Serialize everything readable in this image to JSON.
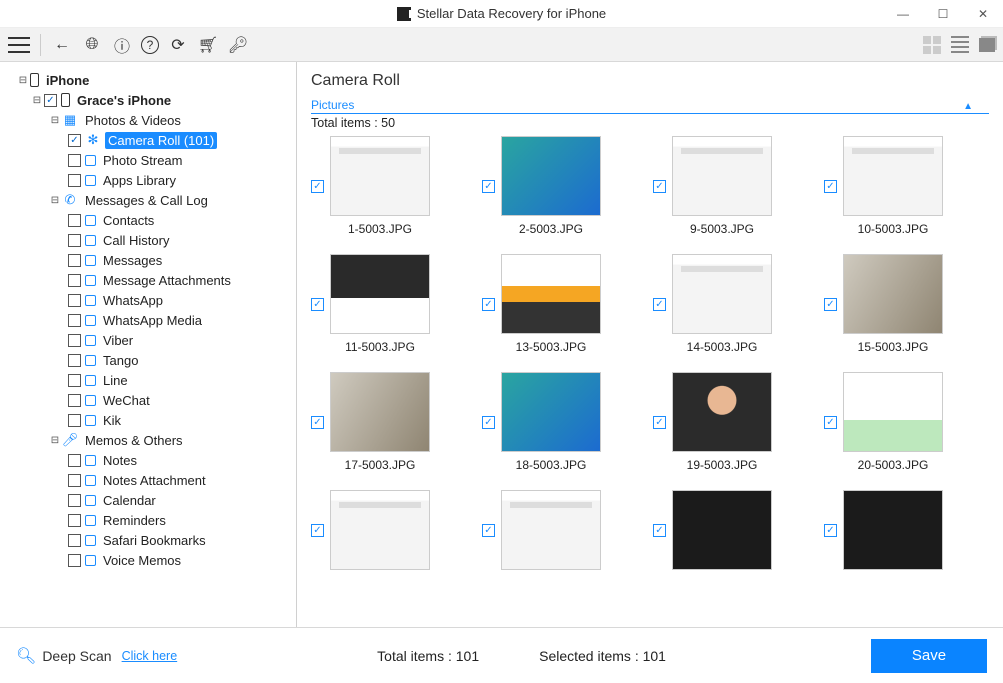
{
  "app_title": "Stellar Data Recovery for iPhone",
  "tree": {
    "root": "iPhone",
    "device": "Grace's iPhone",
    "cat_photos": "Photos & Videos",
    "camera_roll": "Camera Roll (101)",
    "photo_stream": "Photo Stream",
    "apps_library": "Apps Library",
    "cat_msg": "Messages & Call Log",
    "contacts": "Contacts",
    "call_history": "Call History",
    "messages": "Messages",
    "msg_attach": "Message Attachments",
    "whatsapp": "WhatsApp",
    "whatsapp_media": "WhatsApp Media",
    "viber": "Viber",
    "tango": "Tango",
    "line": "Line",
    "wechat": "WeChat",
    "kik": "Kik",
    "cat_memos": "Memos & Others",
    "notes": "Notes",
    "notes_attach": "Notes Attachment",
    "calendar": "Calendar",
    "reminders": "Reminders",
    "safari": "Safari Bookmarks",
    "voice_memos": "Voice Memos"
  },
  "content": {
    "title": "Camera Roll",
    "section": "Pictures",
    "total_label": "Total items : 50"
  },
  "thumbs": [
    {
      "name": "1-5003.JPG",
      "cls": "th-ss"
    },
    {
      "name": "2-5003.JPG",
      "cls": "th-home"
    },
    {
      "name": "9-5003.JPG",
      "cls": "th-ss"
    },
    {
      "name": "10-5003.JPG",
      "cls": "th-ss"
    },
    {
      "name": "11-5003.JPG",
      "cls": "th-promo"
    },
    {
      "name": "13-5003.JPG",
      "cls": "th-orange"
    },
    {
      "name": "14-5003.JPG",
      "cls": "th-ss"
    },
    {
      "name": "15-5003.JPG",
      "cls": "th-photo"
    },
    {
      "name": "17-5003.JPG",
      "cls": "th-photo"
    },
    {
      "name": "18-5003.JPG",
      "cls": "th-home"
    },
    {
      "name": "19-5003.JPG",
      "cls": "th-face"
    },
    {
      "name": "20-5003.JPG",
      "cls": "th-green"
    },
    {
      "name": "",
      "cls": "th-ss"
    },
    {
      "name": "",
      "cls": "th-ss"
    },
    {
      "name": "",
      "cls": "th-dark"
    },
    {
      "name": "",
      "cls": "th-dark"
    }
  ],
  "footer": {
    "deep_scan": "Deep Scan",
    "click_here": "Click here",
    "total": "Total items : 101",
    "selected": "Selected items : 101",
    "save": "Save"
  }
}
